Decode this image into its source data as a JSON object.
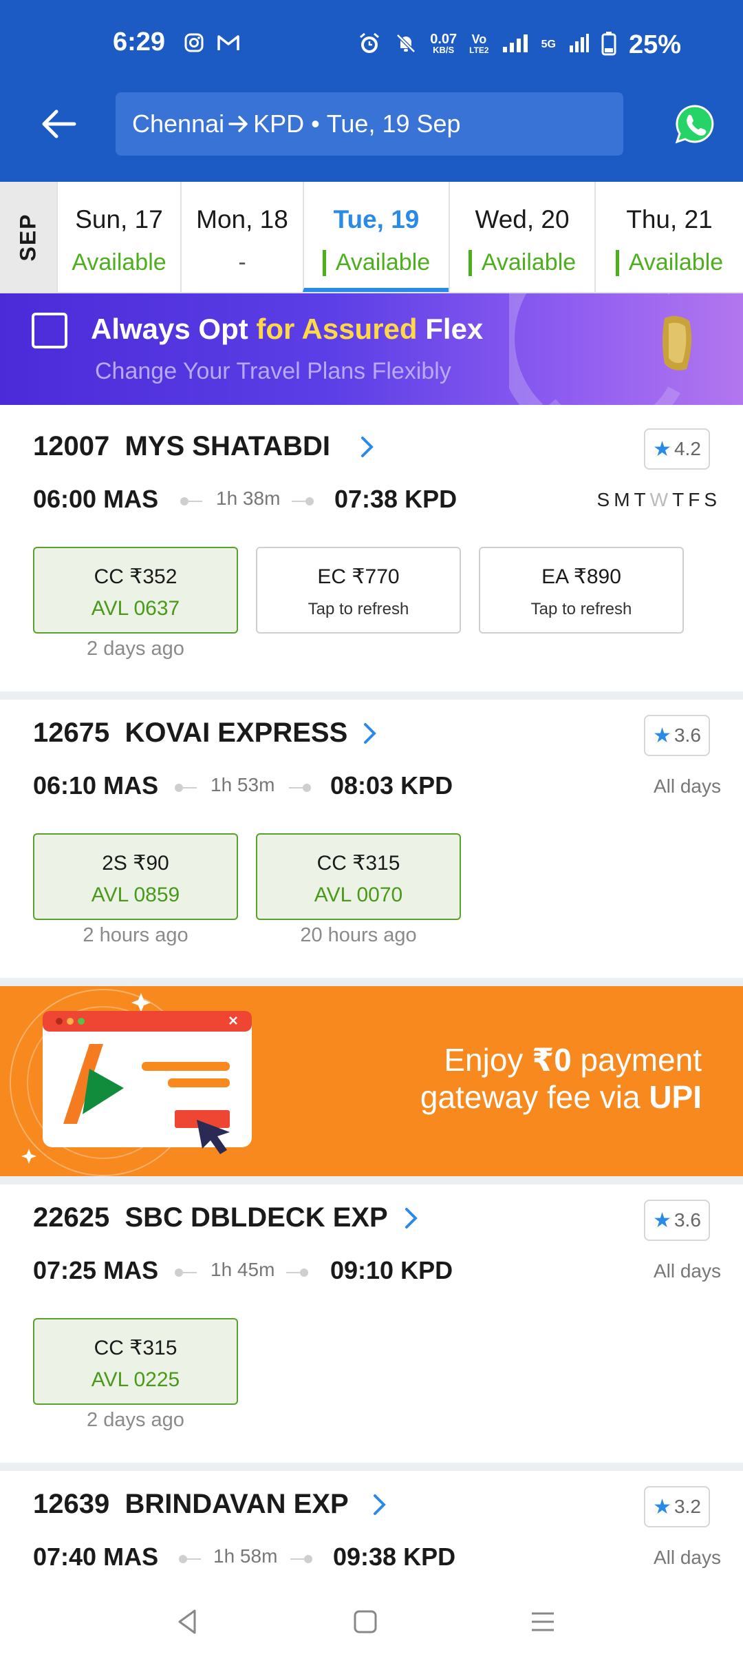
{
  "status_bar": {
    "time": "6:29",
    "speed_value": "0.07",
    "speed_unit": "KB/S",
    "volte": "Vo",
    "volte_sub": "LTE2",
    "network": "5G",
    "battery": "25%"
  },
  "header": {
    "from": "Chennai",
    "to": "KPD",
    "date": "Tue, 19 Sep"
  },
  "date_strip": {
    "month": "SEP",
    "dates": [
      {
        "day": "Sun, 17",
        "status": "Available"
      },
      {
        "day": "Mon, 18",
        "status": "-"
      },
      {
        "day": "Tue, 19",
        "status": "Available"
      },
      {
        "day": "Wed, 20",
        "status": "Available"
      },
      {
        "day": "Thu, 21",
        "status": "Available"
      }
    ]
  },
  "flex_banner": {
    "title_part1": "Always Opt ",
    "title_highlight": "for Assured",
    "title_part2": " Flex",
    "subtitle": "Change Your Travel Plans Flexibly"
  },
  "trains": [
    {
      "number": "12007",
      "name": "MYS SHATABDI",
      "rating": "4.2",
      "dep": "06:00 MAS",
      "duration": "1h 38m",
      "arr": "07:38 KPD",
      "days": [
        "S",
        "M",
        "T",
        "W",
        "T",
        "F",
        "S"
      ],
      "fares": [
        {
          "cls": "CC  ₹352",
          "status": "AVL 0637",
          "updated": "2 days ago"
        },
        {
          "cls": "EC  ₹770",
          "status": "Tap to refresh",
          "updated": ""
        },
        {
          "cls": "EA  ₹890",
          "status": "Tap to refresh",
          "updated": ""
        }
      ]
    },
    {
      "number": "12675",
      "name": "KOVAI EXPRESS",
      "rating": "3.6",
      "dep": "06:10 MAS",
      "duration": "1h 53m",
      "arr": "08:03 KPD",
      "runs": "All days",
      "fares": [
        {
          "cls": "2S  ₹90",
          "status": "AVL 0859",
          "updated": "2 hours ago"
        },
        {
          "cls": "CC  ₹315",
          "status": "AVL 0070",
          "updated": "20 hours ago"
        }
      ]
    },
    {
      "number": "22625",
      "name": "SBC DBLDECK EXP",
      "rating": "3.6",
      "dep": "07:25 MAS",
      "duration": "1h 45m",
      "arr": "09:10 KPD",
      "runs": "All days",
      "fares": [
        {
          "cls": "CC  ₹315",
          "status": "AVL 0225",
          "updated": "2 days ago"
        }
      ]
    },
    {
      "number": "12639",
      "name": "BRINDAVAN EXP",
      "rating": "3.2",
      "dep": "07:40 MAS",
      "duration": "1h 58m",
      "arr": "09:38 KPD",
      "runs": "All days"
    }
  ],
  "upi_banner": {
    "line1_a": "Enjoy ",
    "line1_b": "₹0",
    "line1_c": " payment",
    "line2_a": "gateway fee via ",
    "line2_b": "UPI"
  },
  "colors": {
    "header_blue": "#1c5ac4",
    "accent_blue": "#2a8be6",
    "available_green": "#4caf1c",
    "upi_orange": "#f7891e"
  },
  "icons": {
    "back": "arrow-left-icon",
    "whatsapp": "whatsapp-icon",
    "chevron": "chevron-right-icon",
    "star": "star-icon"
  }
}
